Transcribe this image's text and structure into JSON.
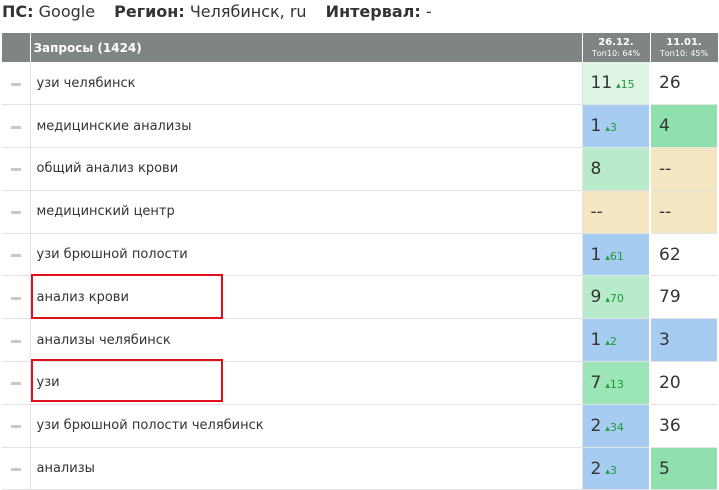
{
  "filters": {
    "ps_label": "ПС:",
    "ps_value": "Google",
    "region_label": "Регион:",
    "region_value": "Челябинск, ru",
    "interval_label": "Интервал:",
    "interval_value": "-"
  },
  "table": {
    "query_header": "Запросы (1424)",
    "dates": [
      {
        "date": "26.12.",
        "top": "Топ10: 64%"
      },
      {
        "date": "11.01.",
        "top": "Топ10: 45%"
      }
    ],
    "rows": [
      {
        "query": "узи челябинск",
        "p1": "11",
        "c1": "15",
        "p2": "26",
        "bg1": "lgreen",
        "bg2": "white"
      },
      {
        "query": "медицинские анализы",
        "p1": "1",
        "c1": "3",
        "p2": "4",
        "bg1": "blue",
        "bg2": "green2"
      },
      {
        "query": "общий анализ крови",
        "p1": "8",
        "c1": "",
        "p2": "--",
        "bg1": "green",
        "bg2": "sand"
      },
      {
        "query": "медицинский центр",
        "p1": "--",
        "c1": "",
        "p2": "--",
        "bg1": "sand",
        "bg2": "sand"
      },
      {
        "query": "узи брюшной полости",
        "p1": "1",
        "c1": "61",
        "p2": "62",
        "bg1": "blue",
        "bg2": "white"
      },
      {
        "query": "анализ крови",
        "p1": "9",
        "c1": "70",
        "p2": "79",
        "bg1": "green",
        "bg2": "white"
      },
      {
        "query": "анализы челябинск",
        "p1": "1",
        "c1": "2",
        "p2": "3",
        "bg1": "blue",
        "bg2": "blue"
      },
      {
        "query": "узи",
        "p1": "7",
        "c1": "13",
        "p2": "20",
        "bg1": "mgreen",
        "bg2": "white"
      },
      {
        "query": "узи брюшной полости челябинск",
        "p1": "2",
        "c1": "34",
        "p2": "36",
        "bg1": "blue",
        "bg2": "white"
      },
      {
        "query": "анализы",
        "p1": "2",
        "c1": "3",
        "p2": "5",
        "bg1": "blue",
        "bg2": "green2"
      }
    ]
  },
  "colors": {
    "header_bg": "#7f8582",
    "change_up": "#1e9a3a",
    "highlight": "#e0101a"
  }
}
